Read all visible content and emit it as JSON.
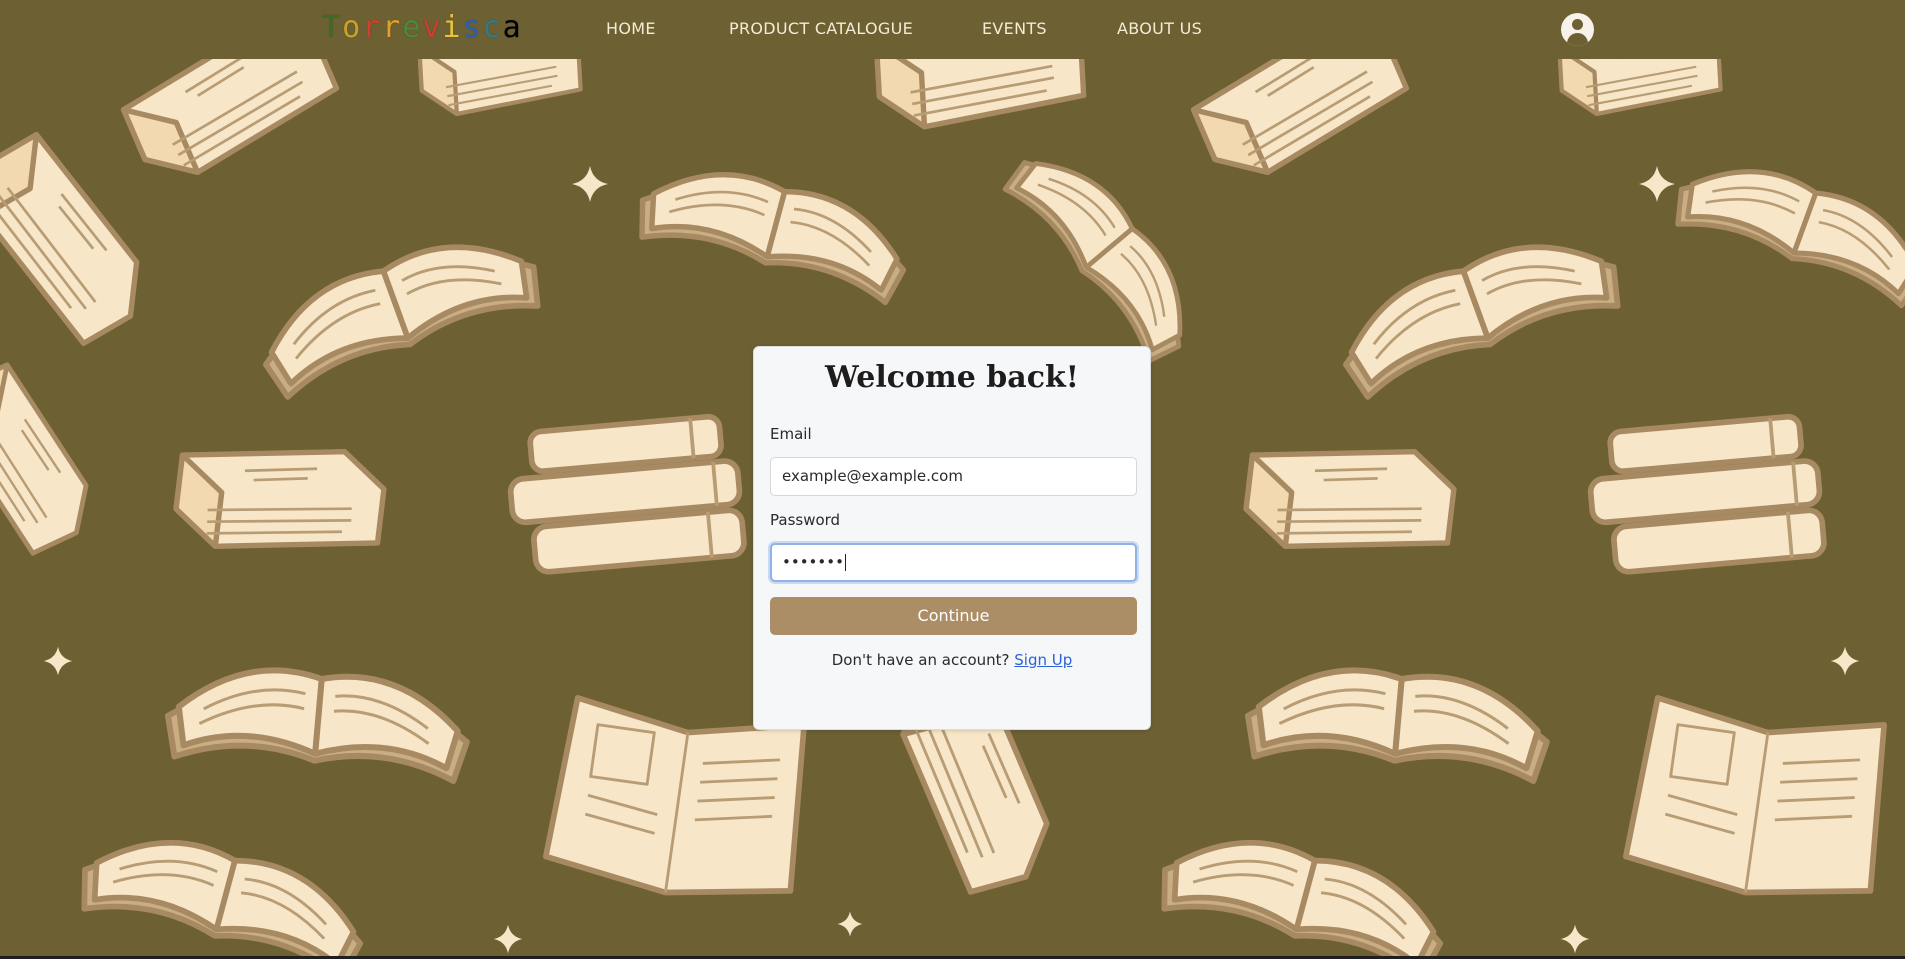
{
  "brand": {
    "logo_letters": [
      "T",
      "o",
      "r",
      "r",
      "e",
      "v",
      "i",
      "s",
      "c",
      "a"
    ]
  },
  "nav": {
    "items": [
      {
        "label": "HOME"
      },
      {
        "label": "PRODUCT CATALOGUE"
      },
      {
        "label": "EVENTS"
      },
      {
        "label": "ABOUT US"
      }
    ],
    "account_icon": "user-circle-icon"
  },
  "login": {
    "title": "Welcome back!",
    "email_label": "Email",
    "email_placeholder": "example@example.com",
    "password_label": "Password",
    "password_value": "•••••••",
    "continue_label": "Continue",
    "signup_prompt": "Don't have an account?",
    "signup_link": "Sign Up"
  },
  "colors": {
    "background": "#6d6033",
    "book_page": "#f8e6c8",
    "book_outline": "#a78a62",
    "button": "#ac8e66",
    "link": "#2b63d9"
  }
}
